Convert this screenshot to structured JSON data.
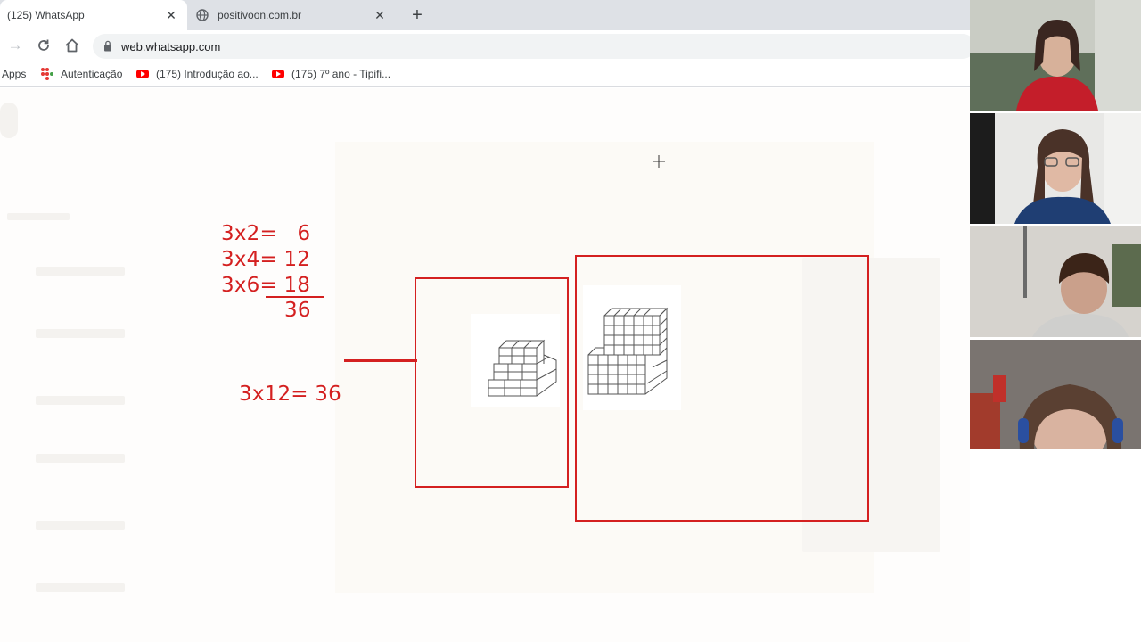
{
  "browser": {
    "tabs": [
      {
        "title": "(125) WhatsApp",
        "active": true
      },
      {
        "title": "positivoon.com.br",
        "active": false
      }
    ],
    "url": "web.whatsapp.com",
    "bookmarks": [
      {
        "label": "Apps",
        "icon": "apps-grid-icon"
      },
      {
        "label": "Autenticação",
        "icon": "autenticacao-icon"
      },
      {
        "label": "(175) Introdução ao...",
        "icon": "youtube-icon"
      },
      {
        "label": "(175) 7º ano - Tipifi...",
        "icon": "youtube-icon"
      }
    ]
  },
  "annotations": {
    "line1": "3x2=   6",
    "line2": "3x4= 12",
    "line3": "3x6= 18",
    "sum": "36",
    "result": "3x12= 36"
  },
  "colors": {
    "annotation_red": "#d42020",
    "chrome_tabstrip": "#dee1e6",
    "omnibox": "#f1f3f4"
  },
  "video_participants": [
    {
      "name": "participant-1"
    },
    {
      "name": "participant-2"
    },
    {
      "name": "participant-3"
    },
    {
      "name": "participant-4"
    }
  ]
}
